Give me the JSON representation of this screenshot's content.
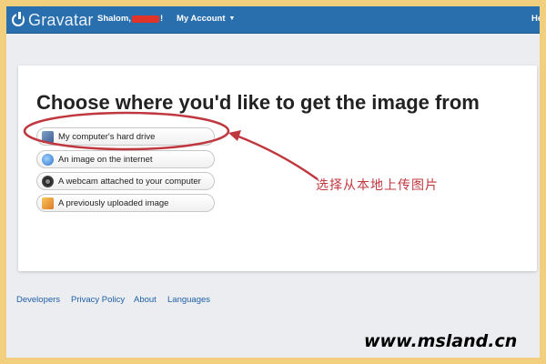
{
  "header": {
    "logo_text": "Gravatar",
    "greeting_prefix": "Shalom,",
    "greeting_suffix": "!",
    "account_menu": "My Account",
    "help_label": "He"
  },
  "main": {
    "heading": "Choose where you'd like to get the image from",
    "options": [
      {
        "label": "My computer's hard drive",
        "icon": "hard-drive-icon"
      },
      {
        "label": "An image on the internet",
        "icon": "globe-icon"
      },
      {
        "label": "A webcam attached to your computer",
        "icon": "webcam-icon"
      },
      {
        "label": "A previously uploaded image",
        "icon": "image-icon"
      }
    ]
  },
  "annotation": {
    "text": "选择从本地上传图片",
    "color": "#c0383f"
  },
  "footer": {
    "links": [
      "Developers",
      "Privacy Policy",
      "About",
      "Languages"
    ]
  },
  "watermark": "www.msland.cn",
  "colors": {
    "topbar": "#2a6fad",
    "frame": "#f1cf7e",
    "link": "#1f5fa6"
  }
}
